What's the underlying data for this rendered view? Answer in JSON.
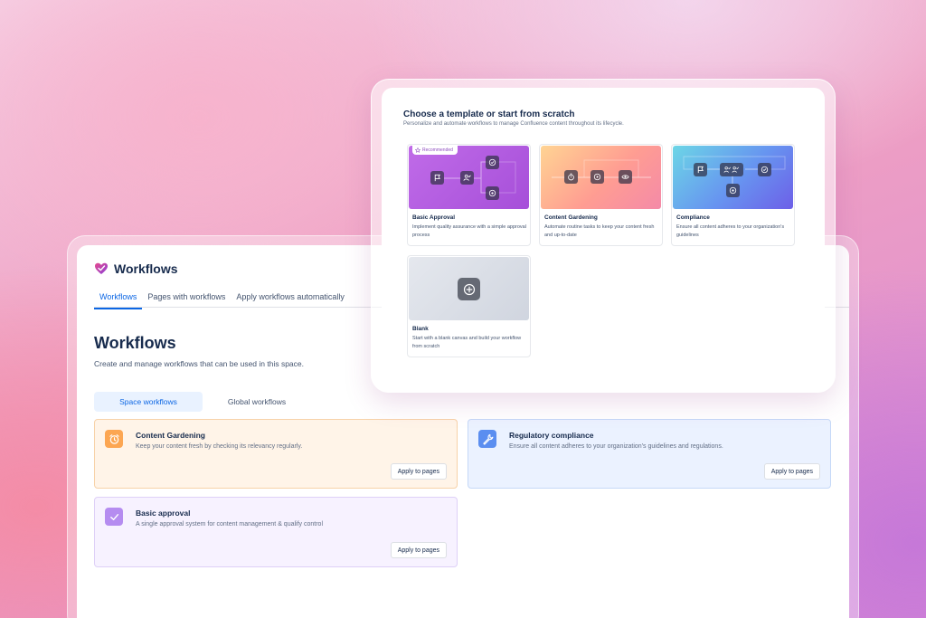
{
  "app": {
    "title": "Workflows",
    "nav_tabs": [
      {
        "label": "Workflows",
        "active": true
      },
      {
        "label": "Pages with workflows",
        "active": false
      },
      {
        "label": "Apply workflows automatically",
        "active": false
      }
    ]
  },
  "main": {
    "title": "Workflows",
    "subtitle": "Create and manage workflows that can be used in this space.",
    "segments": [
      {
        "label": "Space workflows",
        "active": true
      },
      {
        "label": "Global workflows",
        "active": false
      }
    ],
    "workflows": [
      {
        "name": "Content Gardening",
        "description": "Keep your content fresh by checking its relevancy regularly.",
        "button": "Apply to pages",
        "icon": "alarm-clock-icon",
        "color": "#fca652"
      },
      {
        "name": "Regulatory compliance",
        "description": "Ensure all content adheres to your organization's guidelines and regulations.",
        "button": "Apply to pages",
        "icon": "wrench-icon",
        "color": "#5b8ef0"
      },
      {
        "name": "Basic approval",
        "description": "A single approval system for content management & qualify control",
        "button": "Apply to pages",
        "icon": "checkmark-icon",
        "color": "#b58cf0"
      }
    ]
  },
  "template_chooser": {
    "title": "Choose a template or start from scratch",
    "subtitle": "Personalize and automate workflows to manage Confluence content throughout its lifecycle.",
    "templates": [
      {
        "name": "Basic Approval",
        "description": "Implement quality assurance with a simple approval process",
        "badge": "Recommended"
      },
      {
        "name": "Content Gardening",
        "description": "Automate routine tasks to keep your content fresh and up-to-date"
      },
      {
        "name": "Compliance",
        "description": "Ensure all content adheres to your organization's guidelines"
      },
      {
        "name": "Blank",
        "description": "Start with a blank canvas and build your workflow from scratch"
      }
    ]
  }
}
